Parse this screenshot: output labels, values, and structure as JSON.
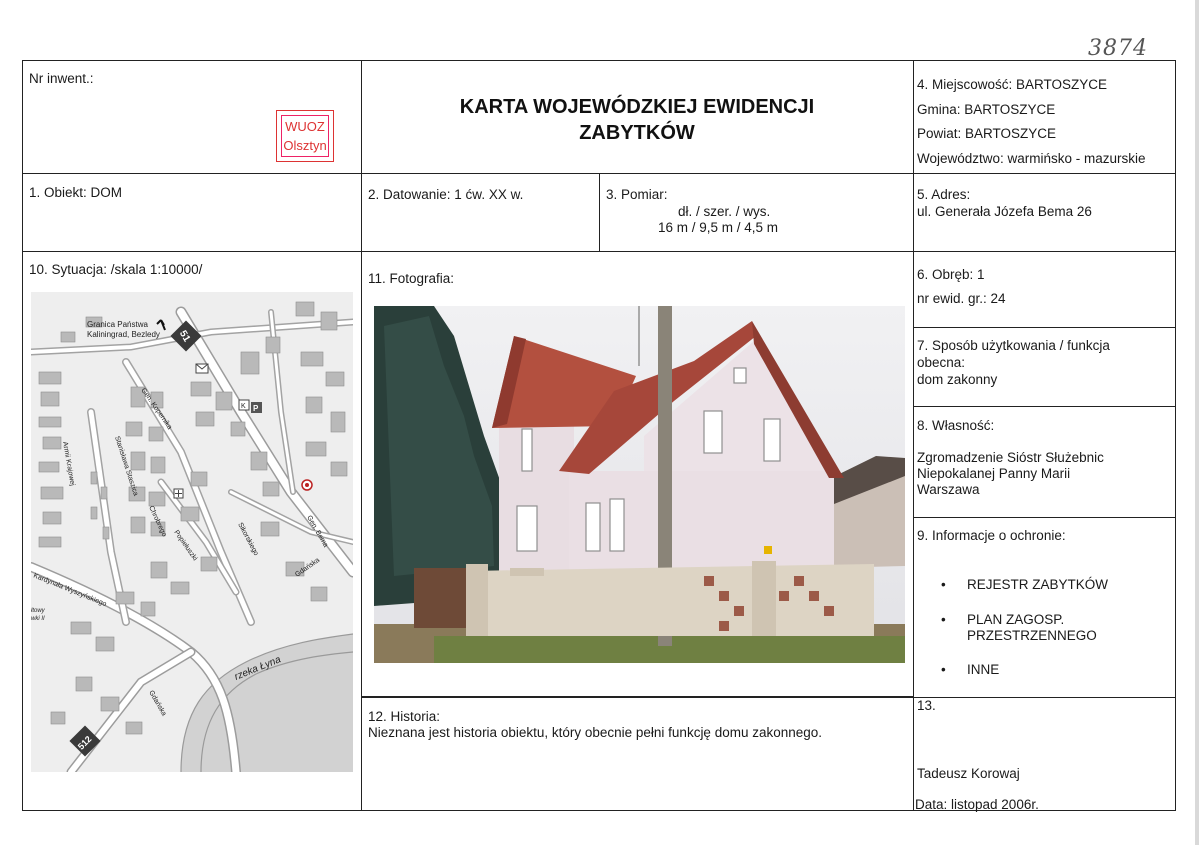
{
  "handwritten_number": "3874",
  "header": {
    "nr_inwent": "Nr inwent.:",
    "title_line1": "KARTA WOJEWÓDZKIEJ EWIDENCJI",
    "title_line2": "ZABYTKÓW",
    "stamp_line1": "WUOZ",
    "stamp_line2": "Olsztyn",
    "miejscowosc": "4. Miejscowość: BARTOSZYCE",
    "gmina": "Gmina: BARTOSZYCE",
    "powiat": "Powiat: BARTOSZYCE",
    "wojewodztwo": "Województwo: warmińsko - mazurskie"
  },
  "row2": {
    "obiekt": "1. Obiekt: DOM",
    "datowanie": "2. Datowanie: 1 ćw. XX w.",
    "pomiar_label": "3. Pomiar:",
    "pomiar_dims": "dł. / szer. / wys.",
    "pomiar_values": "16 m / 9,5 m / 4,5 m",
    "adres_label": "5. Adres:",
    "adres_value": "ul. Generała Józefa Bema 26"
  },
  "sytuacja": "10. Sytuacja: /skala 1:10000/",
  "map_labels": {
    "border_line1": "Granica Państwa",
    "border_line2": "Kaliningrad, Bezledy",
    "road_51": "51",
    "road_512": "512",
    "river": "rzeka Łyna",
    "street_armii": "Armii Krajowej",
    "street_kopernika": "Gen. Kopernika",
    "street_popieluszki": "Popiełuszki",
    "street_sikorskiego": "Sikorskiego",
    "street_bema": "Gen. Bema",
    "street_gdanska": "Gdańska",
    "street_wyszynskiego": "Kardynała Wyszyńskiego",
    "street_gdanska2": "Gdańska",
    "street_chrobrego": "Chrobrego",
    "street_staszica": "Stanisława Staszica",
    "edge_text1": "łtowy",
    "edge_text2": "wki II",
    "letter_k": "K",
    "letter_p": "P"
  },
  "fotografia": "11. Fotografia:",
  "obreb": "6. Obręb: 1",
  "nr_ewid": "nr ewid. gr.: 24",
  "sposob_label1": "7. Sposób użytkowania / funkcja",
  "sposob_label2": "obecna:",
  "sposob_value": "dom zakonny",
  "wlasnosc_label": "8. Własność:",
  "wlasnosc_line1": "Zgromadzenie Sióstr Służebnic",
  "wlasnosc_line2": "Niepokalanej Panny Marii",
  "wlasnosc_line3": "Warszawa",
  "ochrona_label": "9. Informacje o ochronie:",
  "ochrona_items": [
    "REJESTR ZABYTKÓW",
    "PLAN ZAGOSP.",
    "PRZESTRZENNEGO",
    "INNE"
  ],
  "bullet": "•",
  "historia_label": "12. Historia:",
  "historia_text": "Nieznana jest historia obiektu, który obecnie pełni funkcję domu zakonnego.",
  "box13": "13.",
  "author": "Tadeusz Korowaj",
  "data_date": "Data: listopad 2006r."
}
